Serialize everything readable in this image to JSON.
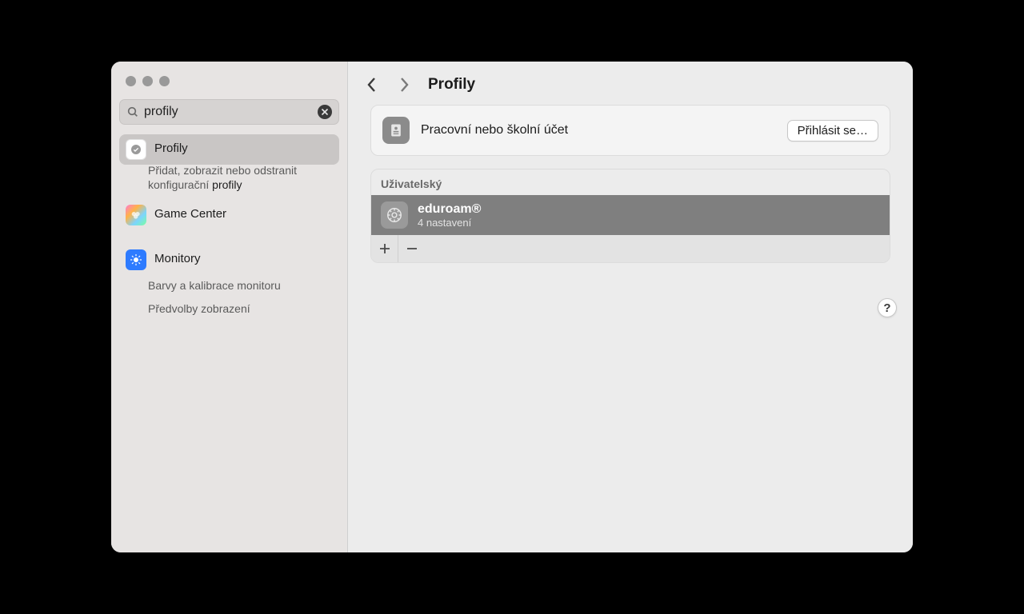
{
  "search": {
    "value": "profily"
  },
  "sidebar": {
    "profiles": {
      "title": "Profily",
      "desc_a": "Přidat, zobrazit nebo odstranit konfigurační ",
      "desc_b": "profily"
    },
    "gamecenter": {
      "title": "Game Center"
    },
    "displays": {
      "title": "Monitory",
      "sub1": "Barvy a kalibrace monitoru",
      "sub2": "Předvolby zobrazení"
    }
  },
  "page": {
    "title": "Profily"
  },
  "account": {
    "label": "Pracovní nebo školní účet",
    "button": "Přihlásit se…"
  },
  "user_section": {
    "header": "Uživatelský"
  },
  "profile": {
    "name": "eduroam®",
    "sub": "4 nastavení"
  },
  "help": "?"
}
